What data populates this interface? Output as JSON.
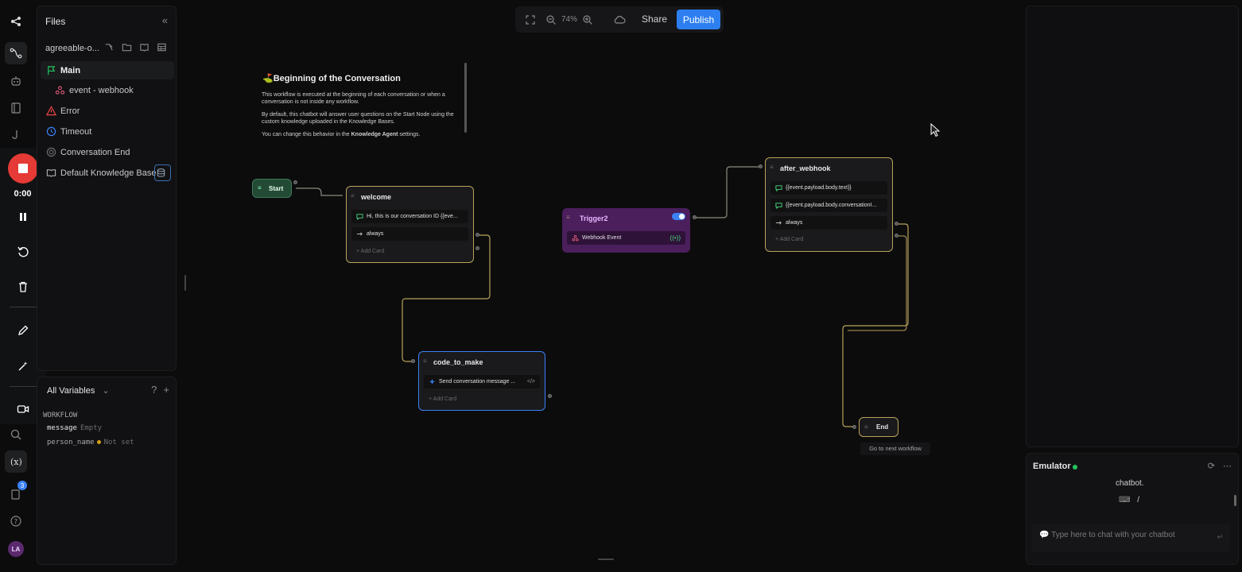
{
  "files": {
    "title": "Files",
    "bot_name": "agreeable-o...",
    "items": [
      {
        "label": "Main"
      },
      {
        "label": "event - webhook"
      },
      {
        "label": "Error"
      },
      {
        "label": "Timeout"
      },
      {
        "label": "Conversation End"
      },
      {
        "label": "Default Knowledge Base"
      }
    ]
  },
  "variables": {
    "filter_label": "All Variables",
    "section": "WORKFLOW",
    "rows": [
      {
        "name": "message",
        "value": "Empty"
      },
      {
        "name": "person_name",
        "value": "Not set"
      }
    ]
  },
  "recorder": {
    "time": "0:00"
  },
  "rail": {
    "badge_count": "3",
    "avatar_initials": "LA"
  },
  "toolbar": {
    "zoom": "74%",
    "share": "Share",
    "publish": "Publish"
  },
  "note": {
    "title": "Beginning of the Conversation",
    "p1": "This workflow is executed at the beginning of each conversation or when a conversation is not inside any workflow.",
    "p2": "By default, this chatbot will answer user questions on the Start Node using the custom knowledge uploaded in the Knowledge Bases.",
    "p3_pre": "You can change this behavior in the ",
    "p3_bold": "Knowledge Agent",
    "p3_post": " settings."
  },
  "nodes": {
    "start": "Start",
    "welcome": {
      "title": "welcome",
      "cards": [
        "Hi, this is our conversation ID {{eve...",
        "always"
      ],
      "add": "Add Card"
    },
    "trigger": {
      "title": "Trigger2",
      "card": "Webhook Event",
      "enabled": true
    },
    "after_webhook": {
      "title": "after_webhook",
      "cards": [
        "{{event.payload.body.text}}",
        "{{event.payload.body.conversationI...",
        "always"
      ],
      "add": "Add Card"
    },
    "code_to_make": {
      "title": "code_to_make",
      "card": "Send conversation message ...",
      "add": "Add Card"
    },
    "end": {
      "title": "End",
      "caption": "Go to next workflow"
    }
  },
  "emulator": {
    "title": "Emulator",
    "last_message": "chatbot.",
    "slash": "/",
    "placeholder": "Type here to chat with your chatbot"
  },
  "colors": {
    "accent": "#2d7ff0",
    "start_node": "#234a35",
    "trigger_node": "#4a1f5c",
    "node_border_yellow": "#b8a25a",
    "node_border_blue": "#3b82f6",
    "record": "#e53a36"
  }
}
